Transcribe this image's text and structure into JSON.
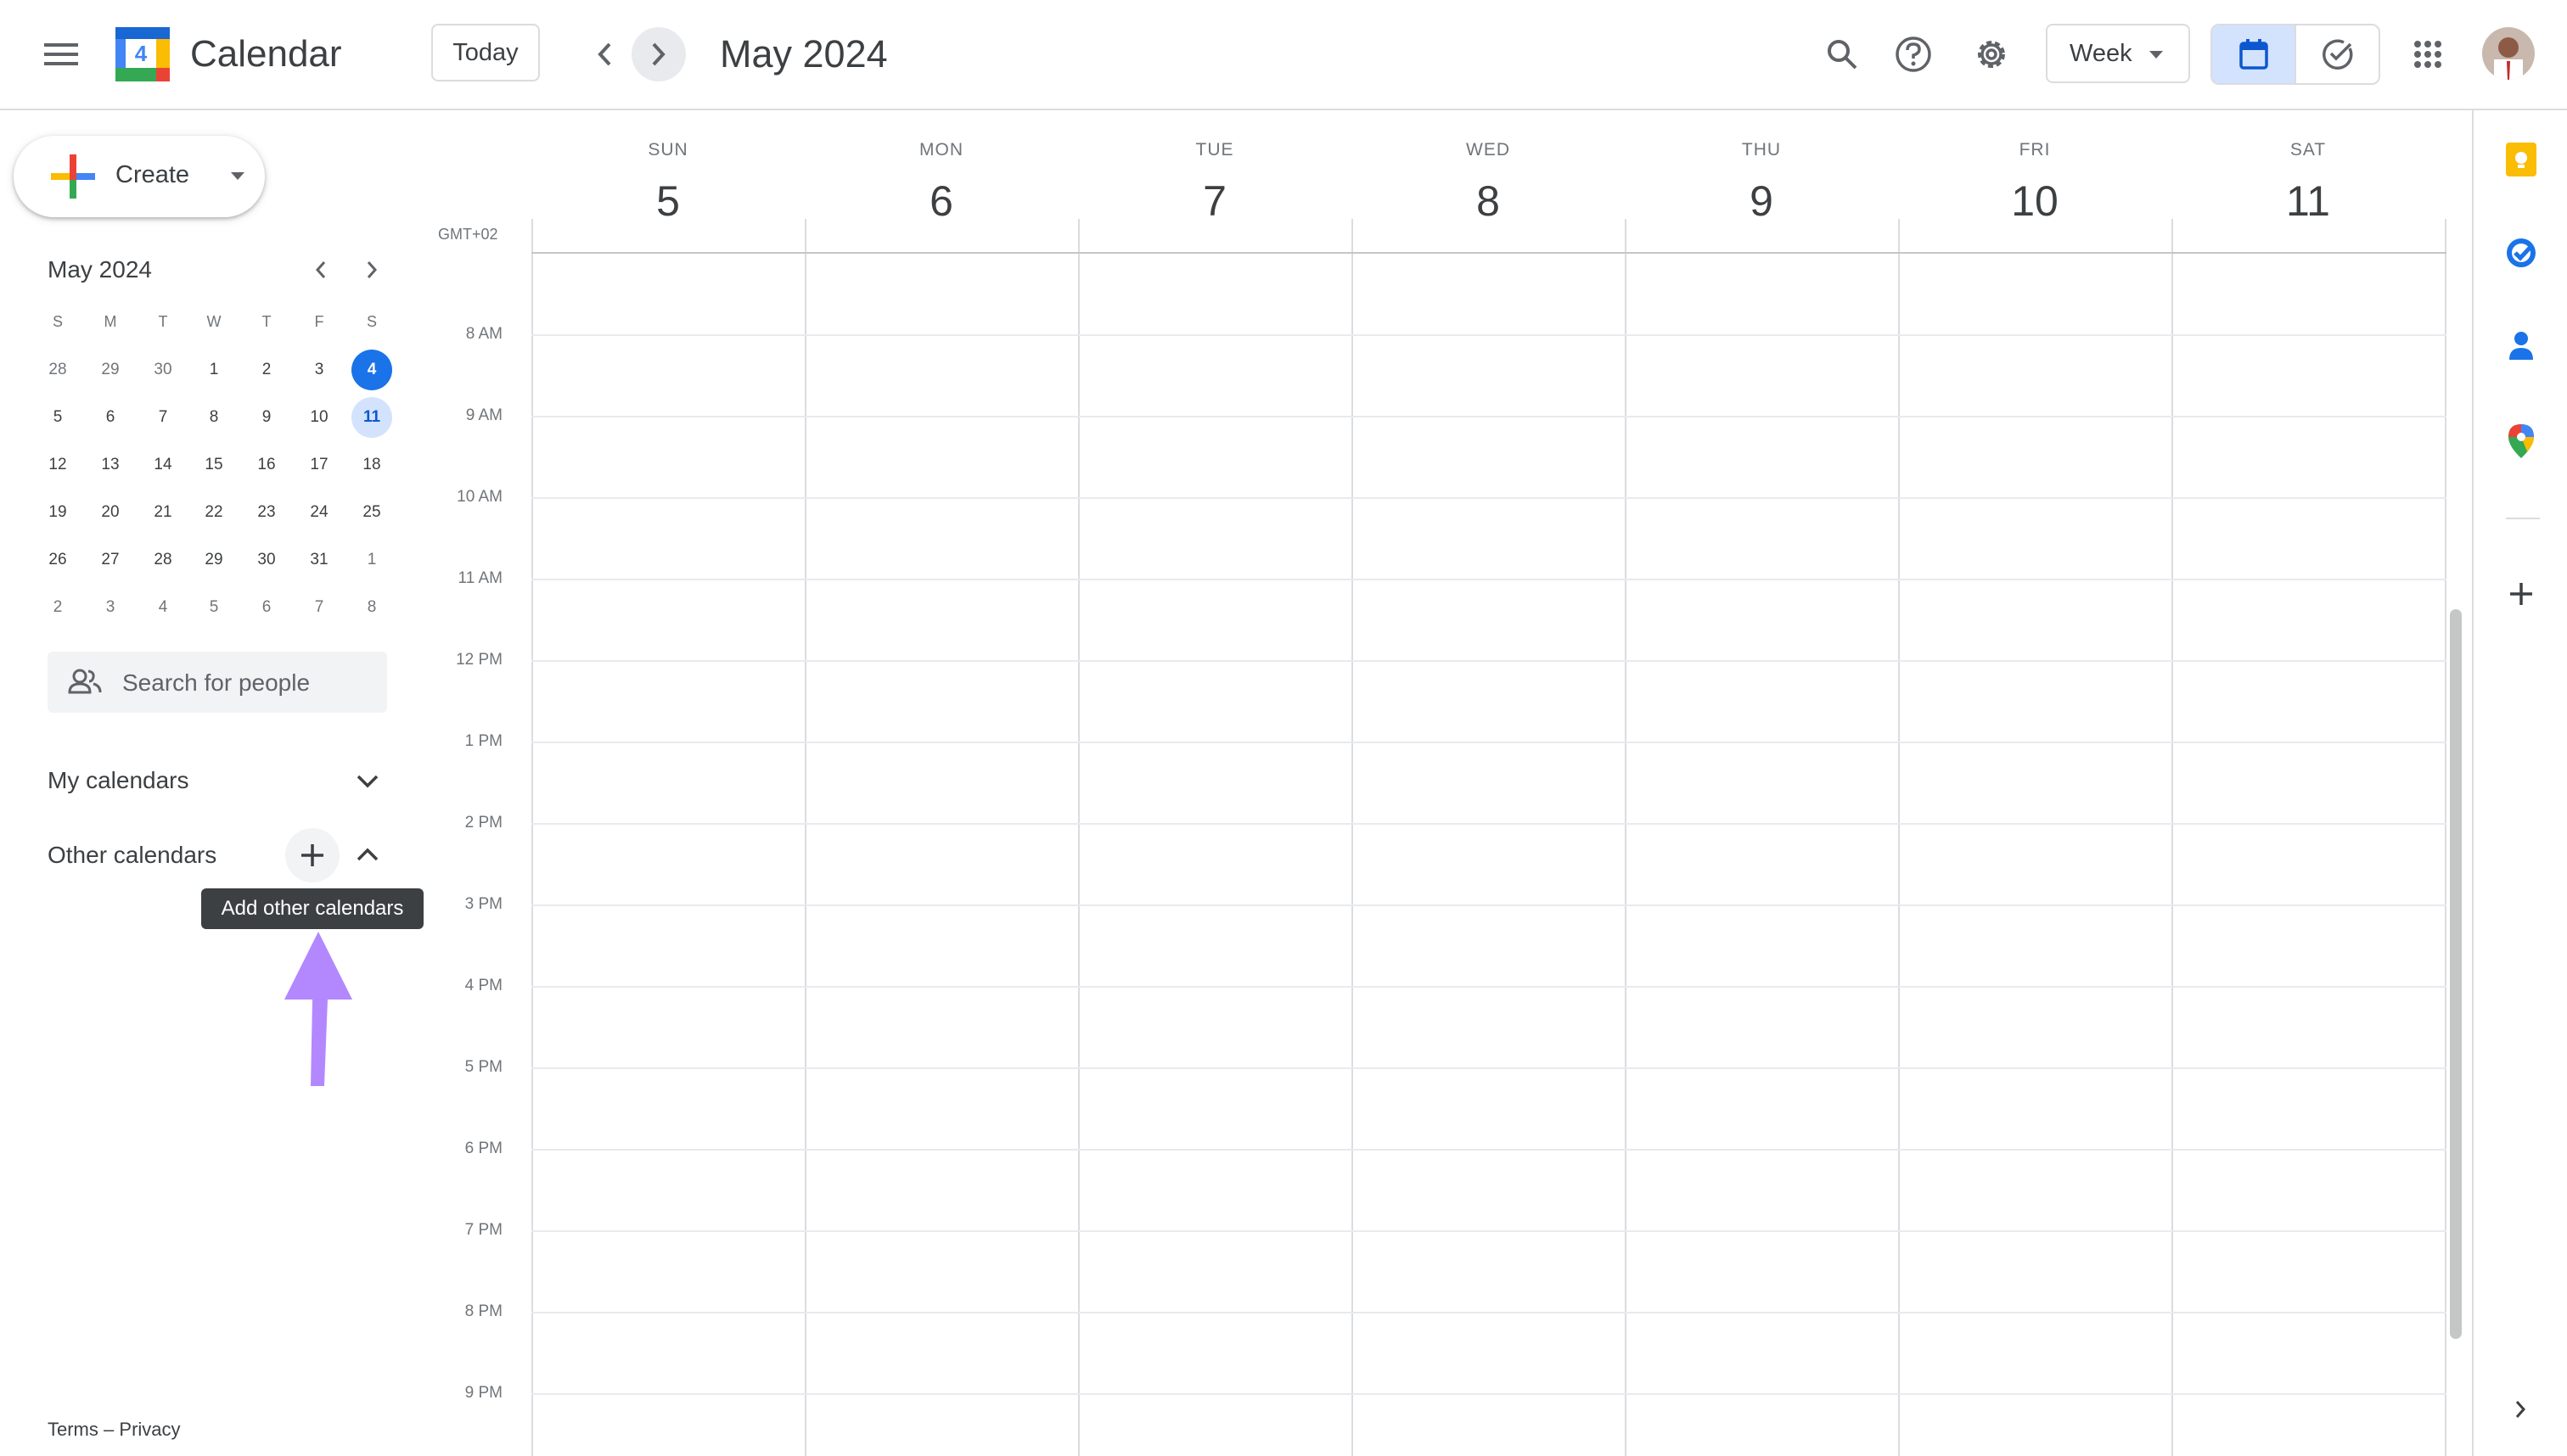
{
  "header": {
    "app_title": "Calendar",
    "logo_day": "4",
    "today_label": "Today",
    "month_label": "May 2024",
    "view_label": "Week"
  },
  "create": {
    "label": "Create"
  },
  "mini_calendar": {
    "title": "May 2024",
    "weekday_heads": [
      "S",
      "M",
      "T",
      "W",
      "T",
      "F",
      "S"
    ],
    "weeks": [
      [
        "28",
        "29",
        "30",
        "1",
        "2",
        "3",
        "4"
      ],
      [
        "5",
        "6",
        "7",
        "8",
        "9",
        "10",
        "11"
      ],
      [
        "12",
        "13",
        "14",
        "15",
        "16",
        "17",
        "18"
      ],
      [
        "19",
        "20",
        "21",
        "22",
        "23",
        "24",
        "25"
      ],
      [
        "26",
        "27",
        "28",
        "29",
        "30",
        "31",
        "1"
      ],
      [
        "2",
        "3",
        "4",
        "5",
        "6",
        "7",
        "8"
      ]
    ]
  },
  "people_search": {
    "placeholder": "Search for people"
  },
  "sections": {
    "my_calendars": "My calendars",
    "other_calendars": "Other calendars"
  },
  "tooltip": {
    "text": "Add other calendars"
  },
  "footer": {
    "terms": "Terms",
    "separator": "–",
    "privacy": "Privacy"
  },
  "week": {
    "timezone": "GMT+02",
    "days": [
      {
        "name": "SUN",
        "num": "5"
      },
      {
        "name": "MON",
        "num": "6"
      },
      {
        "name": "TUE",
        "num": "7"
      },
      {
        "name": "WED",
        "num": "8"
      },
      {
        "name": "THU",
        "num": "9"
      },
      {
        "name": "FRI",
        "num": "10"
      },
      {
        "name": "SAT",
        "num": "11"
      }
    ],
    "hours": [
      "8 AM",
      "9 AM",
      "10 AM",
      "11 AM",
      "12 PM",
      "1 PM",
      "2 PM",
      "3 PM",
      "4 PM",
      "5 PM",
      "6 PM",
      "7 PM",
      "8 PM",
      "9 PM"
    ]
  },
  "colors": {
    "accent_blue": "#1a73e8",
    "selected_bg": "#d3e3fd",
    "annotation_arrow": "#b388ff",
    "tooltip_bg": "#3c4043"
  },
  "icons": [
    "menu-icon",
    "search-icon",
    "help-icon",
    "settings-icon",
    "calendar-view-icon",
    "tasks-view-icon",
    "apps-grid-icon",
    "keep-icon",
    "tasks-icon",
    "contacts-icon",
    "maps-icon",
    "add-icon",
    "chevron-right-icon"
  ]
}
